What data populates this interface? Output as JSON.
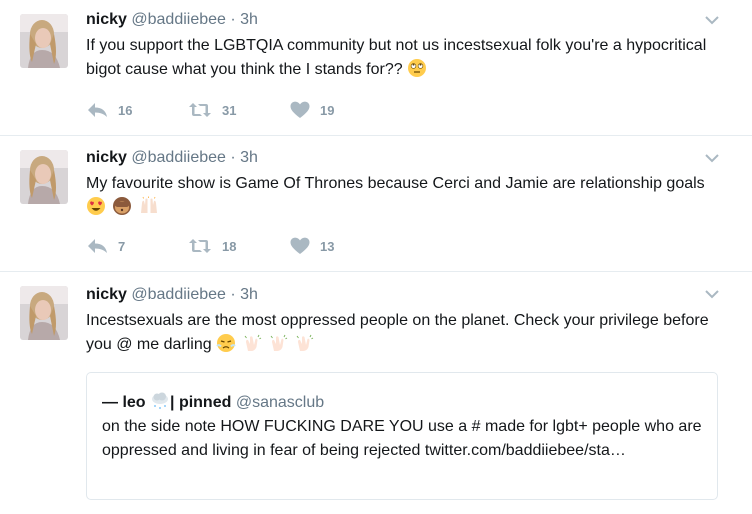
{
  "tweets": [
    {
      "name": "nicky",
      "handle": "@baddiiebee",
      "separator": "·",
      "time": "3h",
      "text": "If you support the LGBTQIA community but not us incestsexual folk you're a hypocritical bigot cause what you think the I stands for??",
      "emojis": [
        "face-with-rolling-eyes"
      ],
      "replies": "16",
      "retweets": "31",
      "likes": "19"
    },
    {
      "name": "nicky",
      "handle": "@baddiiebee",
      "separator": "·",
      "time": "3h",
      "text": "My favourite show is Game Of Thrones because Cerci and Jamie are relationship goals",
      "emojis": [
        "smiling-face-with-heart-eyes",
        "see-no-evil-monkey",
        "raising-hands"
      ],
      "replies": "7",
      "retweets": "18",
      "likes": "13"
    },
    {
      "name": "nicky",
      "handle": "@baddiiebee",
      "separator": "·",
      "time": "3h",
      "text": "Incestsexuals are the most oppressed people on the planet. Check your privilege before you @ me darling",
      "emojis": [
        "face-with-steam-from-nose",
        "clapping-hands",
        "clapping-hands",
        "clapping-hands"
      ]
    }
  ],
  "quote": {
    "name": "— leo",
    "name_suffix": "| pinned",
    "handle": "@sanasclub",
    "emoji": "cloud-with-snow",
    "text": "on the side note HOW FUCKING DARE YOU use a # made for lgbt+ people who are oppressed and living in fear of being rejected twitter.com/baddiiebee/sta…"
  },
  "colors": {
    "name": "#14171a",
    "meta": "#657786",
    "action": "#8899a6",
    "border": "#e6ecf0"
  }
}
